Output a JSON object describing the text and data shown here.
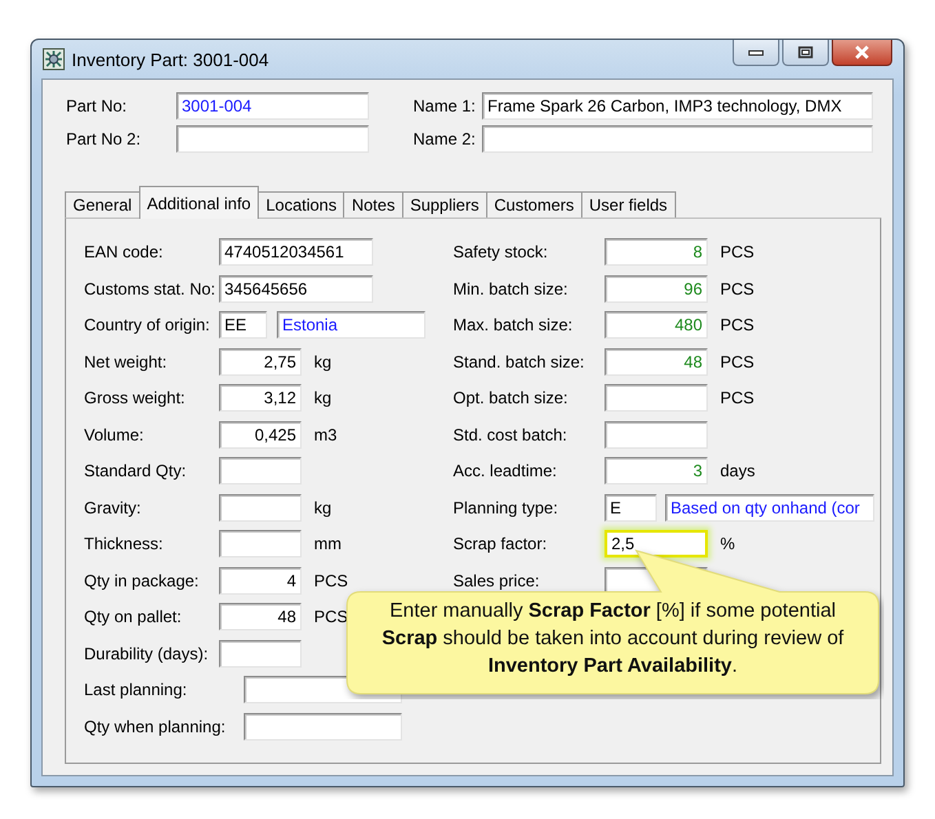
{
  "window": {
    "title": "Inventory Part: 3001-004"
  },
  "header": [
    {
      "label": "Part No:",
      "value": "3001-004",
      "kind": "reference"
    },
    {
      "label": "Name 1:",
      "value": "Frame Spark 26 Carbon, IMP3 technology, DMX",
      "kind": "text"
    },
    {
      "label": "Part No 2:",
      "kind": "text"
    },
    {
      "label": "Name 2:",
      "kind": "text"
    }
  ],
  "tabs": [
    {
      "label": "General",
      "selected": false
    },
    {
      "label": "Additional info",
      "selected": true
    },
    {
      "label": "Locations",
      "selected": false
    },
    {
      "label": "Notes",
      "selected": false
    },
    {
      "label": "Suppliers",
      "selected": false
    },
    {
      "label": "Customers",
      "selected": false
    },
    {
      "label": "User fields",
      "selected": false
    }
  ],
  "left_rows": [
    {
      "label": "EAN code:",
      "fields": [
        {
          "kind": "text",
          "value": "4740512034561"
        }
      ]
    },
    {
      "label": "Customs stat. No:",
      "fields": [
        {
          "kind": "text",
          "value": "345645656"
        }
      ]
    },
    {
      "label": "Country of origin:",
      "fields": [
        {
          "kind": "text",
          "value": "EE"
        },
        {
          "kind": "reference",
          "value": "Estonia"
        }
      ]
    },
    {
      "label": "Net weight:",
      "fields": [
        {
          "kind": "number",
          "value": "2,75"
        }
      ],
      "unit": "kg"
    },
    {
      "label": "Gross weight:",
      "fields": [
        {
          "kind": "number",
          "value": "3,12"
        }
      ],
      "unit": "kg"
    },
    {
      "label": "Volume:",
      "fields": [
        {
          "kind": "number",
          "value": "0,425"
        }
      ],
      "unit": "m3"
    },
    {
      "label": "Standard Qty:",
      "fields": [
        {
          "kind": "number"
        }
      ]
    },
    {
      "label": "Gravity:",
      "fields": [
        {
          "kind": "number"
        }
      ],
      "unit": "kg"
    },
    {
      "label": "Thickness:",
      "fields": [
        {
          "kind": "number"
        }
      ],
      "unit": "mm"
    },
    {
      "label": "Qty in package:",
      "fields": [
        {
          "kind": "number",
          "value": "4"
        }
      ],
      "unit": "PCS"
    },
    {
      "label": "Qty on pallet:",
      "fields": [
        {
          "kind": "number",
          "value": "48"
        }
      ],
      "unit": "PCS"
    },
    {
      "label": "Durability (days):",
      "fields": [
        {
          "kind": "number"
        }
      ]
    }
  ],
  "right_rows": [
    {
      "label": "Safety stock:",
      "fields": [
        {
          "kind": "planned",
          "value": "8",
          "highlighted": false
        }
      ],
      "unit": "PCS"
    },
    {
      "label": "Min. batch size:",
      "fields": [
        {
          "kind": "planned",
          "value": "96",
          "highlighted": false
        }
      ],
      "unit": "PCS"
    },
    {
      "label": "Max. batch size:",
      "fields": [
        {
          "kind": "planned",
          "value": "480",
          "highlighted": false
        }
      ],
      "unit": "PCS"
    },
    {
      "label": "Stand. batch size:",
      "fields": [
        {
          "kind": "planned",
          "value": "48",
          "highlighted": false
        }
      ],
      "unit": "PCS"
    },
    {
      "label": "Opt. batch size:",
      "fields": [
        {
          "kind": "planned",
          "highlighted": false
        }
      ],
      "unit": "PCS"
    },
    {
      "label": "Std. cost batch:",
      "fields": [
        {
          "kind": "planned",
          "highlighted": false
        }
      ]
    },
    {
      "label": "Acc. leadtime:",
      "fields": [
        {
          "kind": "planned",
          "value": "3",
          "highlighted": false
        }
      ],
      "unit": "days"
    },
    {
      "label": "Planning type:",
      "fields": [
        {
          "kind": "text",
          "value": "E",
          "highlighted": false
        },
        {
          "kind": "reference",
          "value": "Based on qty onhand (cor",
          "highlighted": false
        }
      ]
    },
    {
      "label": "Scrap factor:",
      "fields": [
        {
          "kind": "text",
          "value": "2,5",
          "highlighted": true
        }
      ],
      "unit": "%"
    },
    {
      "label": "Sales price:",
      "fields": [
        {
          "kind": "text",
          "highlighted": false
        }
      ]
    }
  ],
  "bottom_rows": [
    {
      "label": "Last planning:"
    },
    {
      "label": "Qty when planning:"
    }
  ],
  "callout": {
    "text": "Enter manually **Scrap Factor** [%] if some potential **Scrap** should be taken into account during review of **Inventory Part Availability**."
  }
}
